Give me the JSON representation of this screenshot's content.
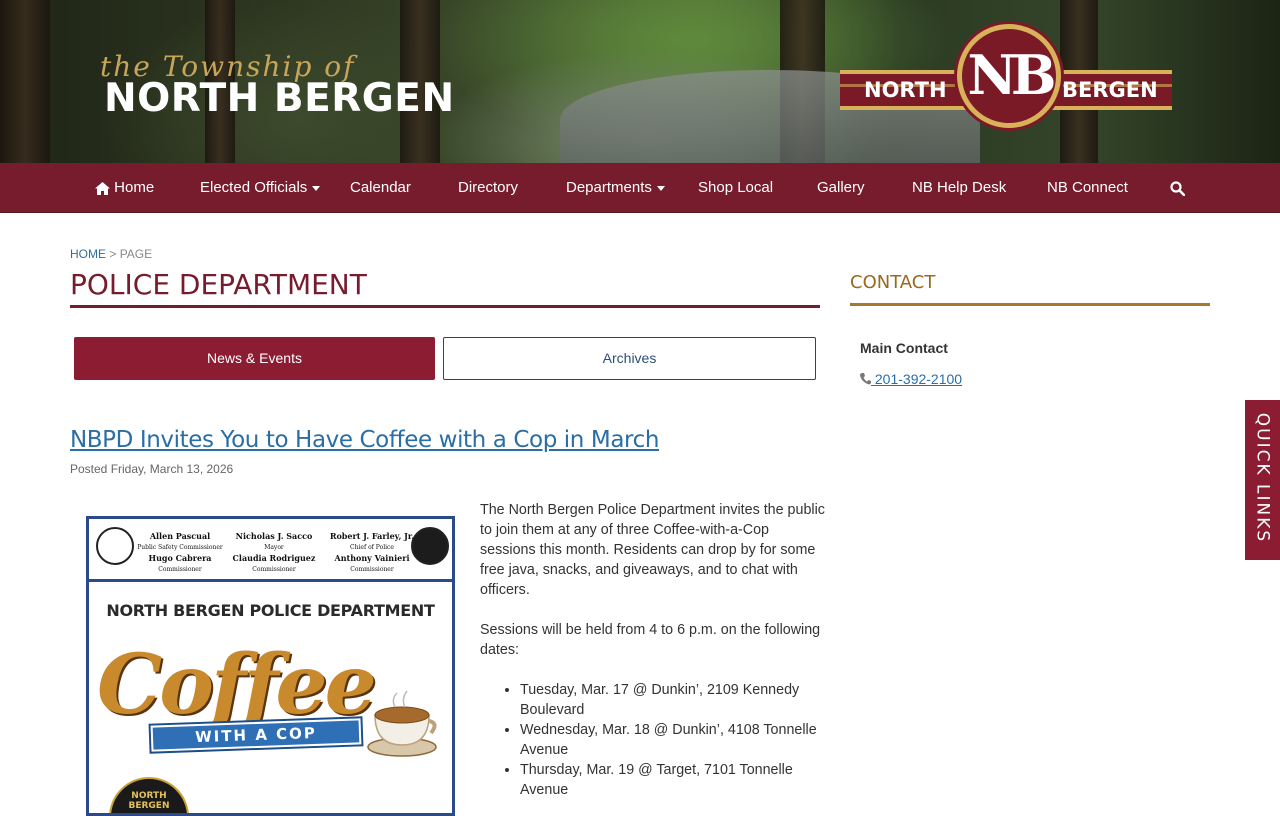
{
  "header": {
    "brand_script": "the Township of",
    "brand_main": "NORTH BERGEN",
    "logo_left": "NORTH",
    "logo_mark": "NB",
    "logo_right": "BERGEN"
  },
  "nav": {
    "home": "Home",
    "elected_officials": "Elected Officials",
    "calendar": "Calendar",
    "directory": "Directory",
    "departments": "Departments",
    "shop_local": "Shop Local",
    "gallery": "Gallery",
    "help_desk": "NB Help Desk",
    "connect": "NB Connect"
  },
  "breadcrumb": {
    "home": "HOME",
    "sep": " > ",
    "current": "PAGE"
  },
  "page_title": "POLICE DEPARTMENT",
  "tabs": {
    "news": "News & Events",
    "archives": "Archives"
  },
  "article": {
    "title": "NBPD Invites You to Have Coffee with a Cop in March",
    "posted": "Posted Friday, March 13, 2026",
    "p1": "The North Bergen Police Department invites the public to join them at any of three Coffee-with-a-Cop sessions this month. Residents can drop by for some free java, snacks, and giveaways, and to chat with officers.",
    "p2": "Sessions will be held from 4 to 6 p.m. on the following dates:",
    "dates": [
      "Tuesday, Mar. 17 @ Dunkin’, 2109 Kennedy Boulevard",
      "Wednesday, Mar. 18 @ Dunkin’, 4108 Tonnelle Avenue",
      "Thursday, Mar. 19 @ Target, 7101 Tonnelle Avenue"
    ]
  },
  "flyer": {
    "col1_name1": "Allen Pascual",
    "col1_role1": "Public Safety Commissioner",
    "col1_name2": "Hugo Cabrera",
    "col1_role2": "Commissioner",
    "col2_name1": "Nicholas J. Sacco",
    "col2_role1": "Mayor",
    "col2_name2": "Claudia Rodriguez",
    "col2_role2": "Commissioner",
    "col3_name1": "Robert J. Farley, Jr.",
    "col3_role1": "Chief of Police",
    "col3_name2": "Anthony Vainieri",
    "col3_role2": "Commissioner",
    "heading": "NORTH BERGEN POLICE DEPARTMENT",
    "coffee": "Coffee",
    "ribbon": "WITH A COP",
    "badge": "NORTH BERGEN"
  },
  "sidebar": {
    "contact_title": "CONTACT",
    "main_contact": "Main Contact",
    "phone": "201-392-2100"
  },
  "quick_links": "QUICK LINKS",
  "colors": {
    "maroon": "#761c2d",
    "tab_active": "#8b1c31",
    "gold": "#a67a2a",
    "link": "#2a6ea6"
  }
}
